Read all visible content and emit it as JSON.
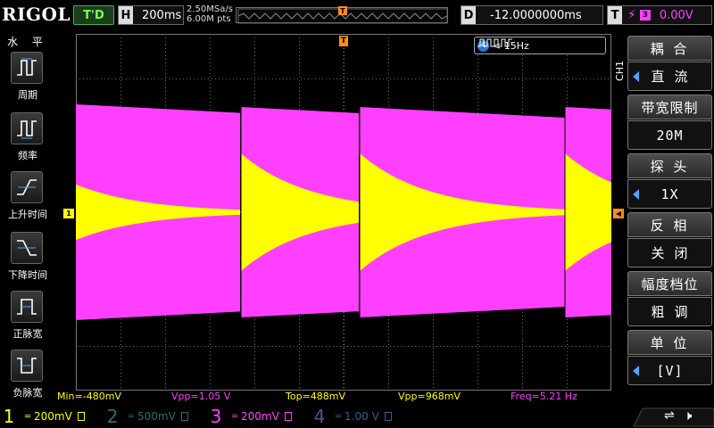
{
  "brand": {
    "logo_text": "RIGOL"
  },
  "topbar": {
    "run_state": "T'D",
    "horizontal": {
      "letter": "H",
      "timebase": "200ms"
    },
    "sample": {
      "rate": "2.50MSa/s",
      "points": "6.00M pts"
    },
    "trigger_marker": "T",
    "delay": {
      "letter": "D",
      "value": "-12.0000000ms"
    },
    "trigger": {
      "letter": "T",
      "source": "3",
      "level": "0.00V"
    }
  },
  "left_menu": {
    "title": "水 平",
    "items": [
      {
        "label": "周期",
        "icon": "period-icon"
      },
      {
        "label": "频率",
        "icon": "frequency-icon"
      },
      {
        "label": "上升时间",
        "icon": "rise-time-icon"
      },
      {
        "label": "下降时间",
        "icon": "fall-time-icon"
      },
      {
        "label": "正脉宽",
        "icon": "positive-width-icon"
      },
      {
        "label": "负脉宽",
        "icon": "negative-width-icon"
      }
    ]
  },
  "scope": {
    "counter_badge": "4",
    "counter_text": "< 15Hz",
    "ch1_marker": "1",
    "trig_marker_top": "T"
  },
  "right_menu": {
    "channel_tag": "CH1",
    "groups": [
      {
        "title": "耦 合",
        "value": "直 流",
        "has_arrow": true
      },
      {
        "title": "带宽限制",
        "value": "20M",
        "has_arrow": false
      },
      {
        "title": "探 头",
        "value": "1X",
        "has_arrow": true
      },
      {
        "title": "反 相",
        "value": "关 闭",
        "has_arrow": false
      },
      {
        "title": "幅度档位",
        "value": "粗 调",
        "has_arrow": false
      },
      {
        "title": "单 位",
        "value": "[V]",
        "has_arrow": true
      }
    ]
  },
  "measurements": [
    {
      "text": "Min=-480mV",
      "color": "#ffff00"
    },
    {
      "text": "Vpp=1.05 V",
      "color": "#ff3fff"
    },
    {
      "text": "Top=488mV",
      "color": "#ffff00"
    },
    {
      "text": "Vpp=968mV",
      "color": "#ffff00"
    },
    {
      "text": "Freq=5.21 Hz",
      "color": "#ff3fff"
    }
  ],
  "channels": [
    {
      "num": "1",
      "scale": "200mV",
      "color": "#ffff00",
      "active": true
    },
    {
      "num": "2",
      "scale": "500mV",
      "color": "#2a6f6f",
      "active": false
    },
    {
      "num": "3",
      "scale": "200mV",
      "color": "#ff3fff",
      "active": true
    },
    {
      "num": "4",
      "scale": "1.00 V",
      "color": "#3a5f8f",
      "active": false
    }
  ],
  "colors": {
    "ch1": "#ffff00",
    "ch3": "#ff3fff",
    "grid": "#5a5a5a",
    "accent": "#4aa6ff"
  }
}
